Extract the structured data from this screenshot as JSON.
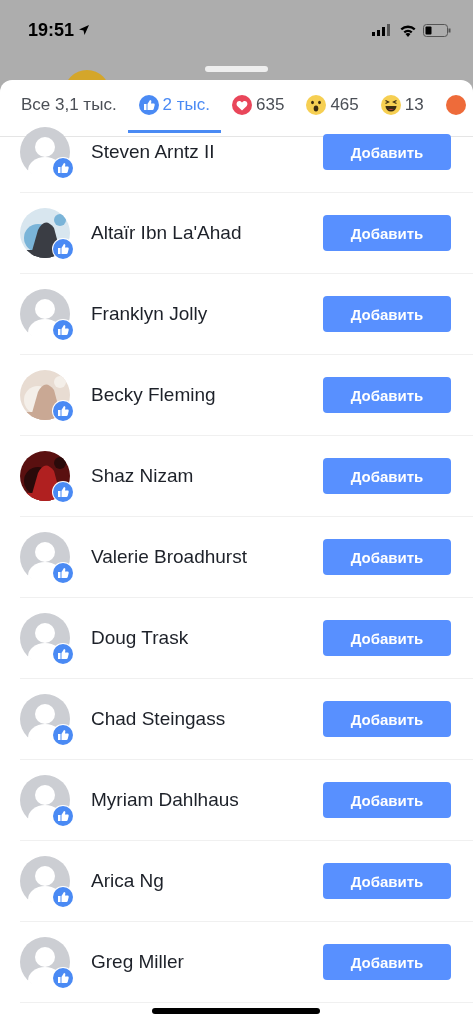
{
  "status_bar": {
    "time": "19:51"
  },
  "tabs": [
    {
      "kind": "all",
      "label": "Все 3,1 тыс.",
      "selected": false
    },
    {
      "kind": "like",
      "label": "2 тыс.",
      "selected": true
    },
    {
      "kind": "love",
      "label": "635",
      "selected": false
    },
    {
      "kind": "wow",
      "label": "465",
      "selected": false
    },
    {
      "kind": "haha",
      "label": "13",
      "selected": false
    },
    {
      "kind": "angry",
      "selected": false
    }
  ],
  "people": [
    {
      "name": "Steven Arntz II",
      "kind": "default",
      "button": "Добавить"
    },
    {
      "name": "Altaïr Ibn La'Ahad",
      "kind": "picture",
      "button": "Добавить"
    },
    {
      "name": "Franklyn Jolly",
      "kind": "default",
      "button": "Добавить"
    },
    {
      "name": "Becky Fleming",
      "kind": "picture",
      "button": "Добавить"
    },
    {
      "name": "Shaz Nizam",
      "kind": "picture",
      "button": "Добавить"
    },
    {
      "name": "Valerie Broadhurst",
      "kind": "default",
      "button": "Добавить"
    },
    {
      "name": "Doug Trask",
      "kind": "default",
      "button": "Добавить"
    },
    {
      "name": "Chad Steingass",
      "kind": "default",
      "button": "Добавить"
    },
    {
      "name": "Myriam Dahlhaus",
      "kind": "default",
      "button": "Добавить"
    },
    {
      "name": "Arica Ng",
      "kind": "default",
      "button": "Добавить"
    },
    {
      "name": "Greg Miller",
      "kind": "default",
      "button": "Добавить"
    }
  ]
}
